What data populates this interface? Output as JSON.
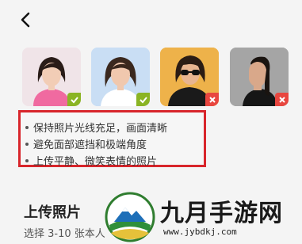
{
  "icons": {
    "back": "chevron-left-icon",
    "ok": "check-icon",
    "bad": "close-icon"
  },
  "photos": [
    {
      "status": "ok"
    },
    {
      "status": "ok"
    },
    {
      "status": "bad"
    },
    {
      "status": "bad"
    }
  ],
  "tips": [
    "保持照片光线充足，画面清晰",
    "避免面部遮挡和极端角度",
    "上传平静、微笑表情的照片"
  ],
  "upload": {
    "title": "上传照片",
    "subtitle": "选择 3-10 张本人"
  },
  "watermark": {
    "name": "九月手游网",
    "url": "www.jybdkj.com"
  },
  "colors": {
    "ok": "#8ab424",
    "bad": "#e8463f",
    "highlight": "#d8252b"
  }
}
